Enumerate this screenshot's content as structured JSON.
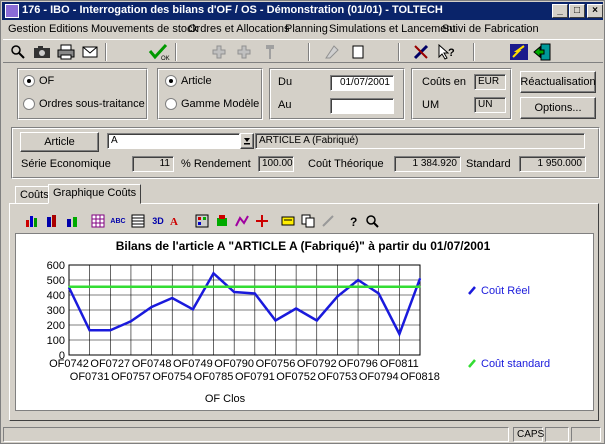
{
  "window": {
    "title": "176 - IBO - Interrogation des bilans d'OF / OS - Démonstration (01/01) - TOLTECH",
    "minimize": "_",
    "maximize": "□",
    "close": "×"
  },
  "menu": [
    "Gestion",
    "Editions",
    "Mouvements de stock",
    "Ordres et Allocations",
    "Planning",
    "Simulations et Lancement",
    "Suivi de Fabrication"
  ],
  "toolbar": {
    "ok_label": "OK",
    "icons": [
      "search-icon",
      "camera-icon",
      "print-icon",
      "mail-icon",
      "ok-check-icon",
      "add-icon",
      "add-icon-2",
      "wrench-icon",
      "erase-icon",
      "new-document-icon",
      "tools-icon",
      "help-pointer-icon",
      "lightning-icon",
      "exit-door-icon"
    ]
  },
  "filters": {
    "source": {
      "options": [
        "OF",
        "Ordres sous-traitance"
      ],
      "selected": "OF"
    },
    "scope": {
      "options": [
        "Article",
        "Gamme Modèle"
      ],
      "selected": "Article"
    },
    "du_label": "Du",
    "du_value": "01/07/2001",
    "au_label": "Au",
    "au_value": "",
    "couts_en_label": "Coûts en",
    "couts_en_value": "EUR",
    "um_label": "UM",
    "um_value": "UN",
    "reactualisation_label": "Réactualisation",
    "options_label": "Options..."
  },
  "article": {
    "button_label": "Article",
    "code": "A",
    "description": "ARTICLE A (Fabriqué)",
    "serie_label": "Série Economique",
    "serie_value": "11",
    "rendement_label": "% Rendement",
    "rendement_value": "100.00",
    "cout_theorique_label": "Coût Théorique",
    "cout_theorique_value": "1 384.920",
    "standard_label": "Standard",
    "standard_value": "1 950.000"
  },
  "tabs": [
    "Coûts",
    "Graphique Coûts"
  ],
  "active_tab": "Graphique Coûts",
  "chart_toolbar": {
    "icons": [
      "bar-chart-icon",
      "3d-bar-icon",
      "stacked-bar-icon",
      "grid-icon",
      "abc-icon",
      "data-table-icon",
      "3d-icon",
      "font-icon",
      "palette-icon",
      "color-fill-icon",
      "chart-style-icon",
      "move-icon",
      "legend-icon",
      "copy-icon",
      "pen-icon",
      "help-icon",
      "zoom-icon"
    ],
    "abc_text": "ABC",
    "3d_text": "3D"
  },
  "chart_data": {
    "type": "line",
    "title": "Bilans de l'article A \"ARTICLE A (Fabriqué)\" à partir du 01/07/2001",
    "xlabel": "OF Clos",
    "ylabel": "",
    "ylim": [
      0,
      600
    ],
    "yticks": [
      0,
      100,
      200,
      300,
      400,
      500,
      600
    ],
    "grid": true,
    "legend_position": "right",
    "categories": [
      "OF0742",
      "OF0731",
      "OF0727",
      "OF0757",
      "OF0748",
      "OF0754",
      "OF0749",
      "OF0785",
      "OF0790",
      "OF0791",
      "OF0756",
      "OF0752",
      "OF0792",
      "OF0753",
      "OF0796",
      "OF0794",
      "OF0811",
      "OF0818"
    ],
    "top_row_labels": [
      "OF0742",
      "OF0727",
      "OF0748",
      "OF0749",
      "OF0790",
      "OF0756",
      "OF0792",
      "OF0796",
      "OF0811"
    ],
    "bottom_row_labels": [
      "OF0731",
      "OF0757",
      "OF0754",
      "OF0785",
      "OF0791",
      "OF0752",
      "OF0753",
      "OF0794",
      "OF0818"
    ],
    "series": [
      {
        "name": "Coût Réel",
        "color": "#1a1adc",
        "values": [
          450,
          165,
          165,
          225,
          320,
          380,
          305,
          545,
          420,
          410,
          230,
          310,
          230,
          390,
          500,
          410,
          140,
          510
        ]
      },
      {
        "name": "Coût standard",
        "color": "#33dd33",
        "values": [
          455,
          455,
          455,
          455,
          455,
          455,
          455,
          455,
          455,
          455,
          455,
          455,
          455,
          455,
          455,
          455,
          455,
          455
        ]
      }
    ]
  },
  "status": {
    "caps": "CAPS"
  }
}
